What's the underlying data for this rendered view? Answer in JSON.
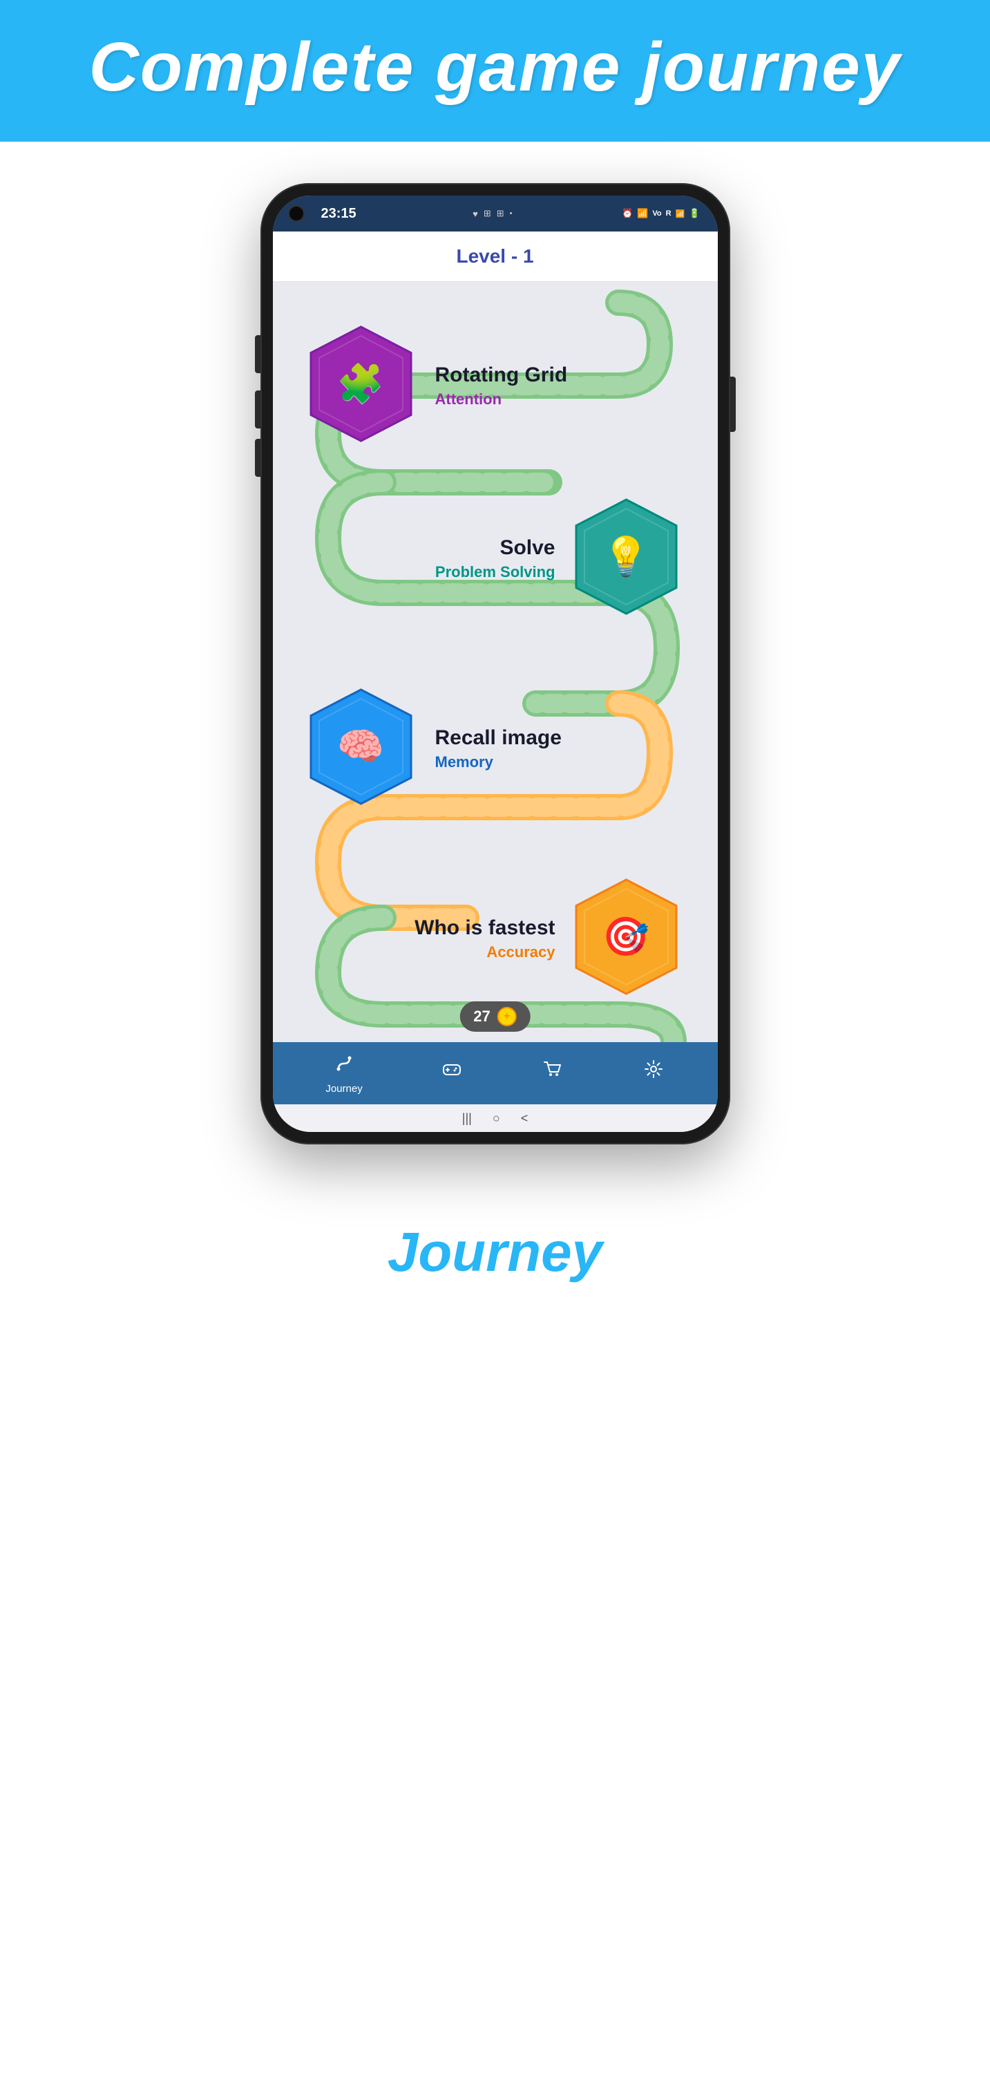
{
  "header": {
    "title": "Complete game journey",
    "background": "#29b6f6"
  },
  "statusBar": {
    "time": "23:15",
    "icons": "⏰ 📶 R LTE↑↓ 🔋"
  },
  "levelHeader": {
    "text": "Level - 1"
  },
  "games": [
    {
      "id": 1,
      "name": "Rotating Grid",
      "category": "Attention",
      "categoryClass": "cat-attention",
      "hexColor": "#9c27b0",
      "hexColor2": "#7b1fa2",
      "icon": "🧩",
      "position": "left"
    },
    {
      "id": 2,
      "name": "Solve",
      "category": "Problem Solving",
      "categoryClass": "cat-problem",
      "hexColor": "#26a69a",
      "hexColor2": "#00897b",
      "icon": "💡",
      "position": "right"
    },
    {
      "id": 3,
      "name": "Recall image",
      "category": "Memory",
      "categoryClass": "cat-memory",
      "hexColor": "#2196f3",
      "hexColor2": "#1565c0",
      "icon": "🧠",
      "position": "left"
    },
    {
      "id": 4,
      "name": "Who is fastest",
      "category": "Accuracy",
      "categoryClass": "cat-accuracy",
      "hexColor": "#f9a825",
      "hexColor2": "#f57f17",
      "icon": "🎯",
      "position": "right"
    }
  ],
  "scoreBadge": {
    "score": "27",
    "coinSymbol": "+"
  },
  "navigation": {
    "items": [
      {
        "label": "Journey",
        "icon": "journey",
        "active": true
      },
      {
        "label": "",
        "icon": "gamepad",
        "active": false
      },
      {
        "label": "",
        "icon": "cart",
        "active": false
      },
      {
        "label": "",
        "icon": "settings",
        "active": false
      }
    ]
  },
  "bottomLabel": {
    "text": "Journey"
  },
  "homeBar": {
    "items": [
      "|||",
      "○",
      "<"
    ]
  }
}
